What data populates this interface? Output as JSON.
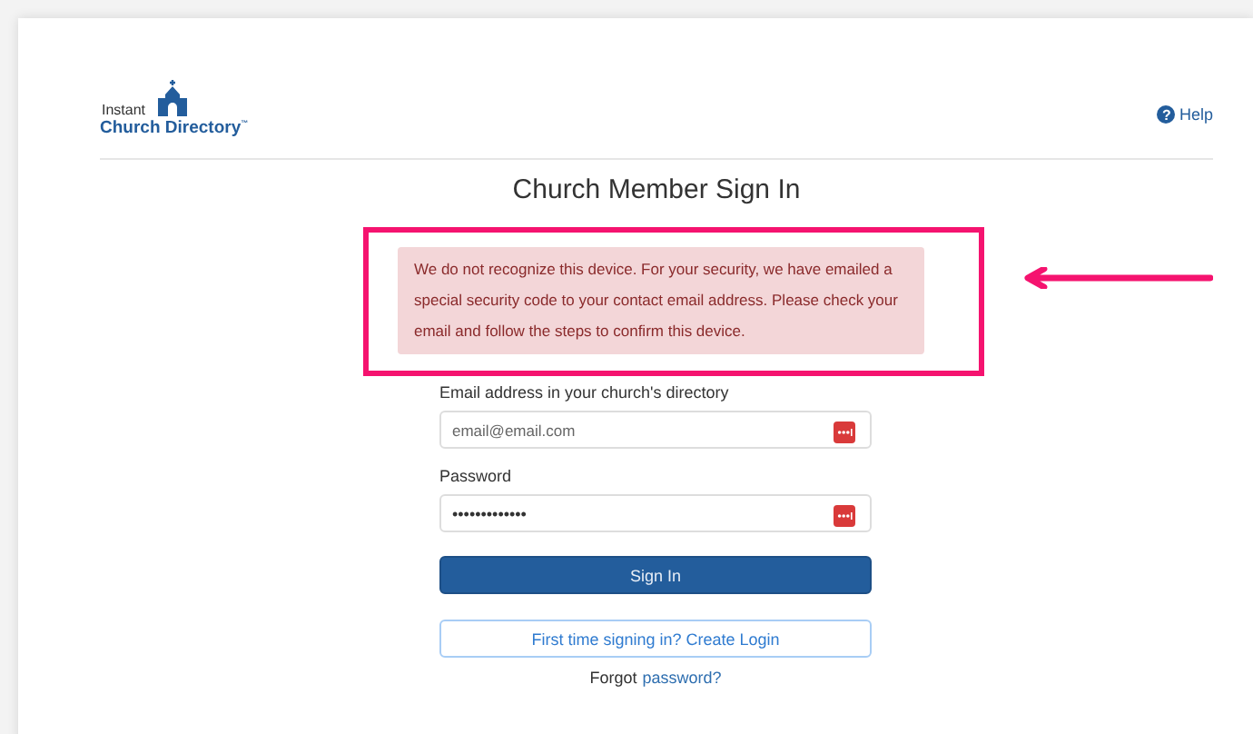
{
  "header": {
    "logo": {
      "line_1": "Instant",
      "line_2": "Church Directory",
      "mark": "™"
    },
    "help_icon": "?",
    "help": "Help"
  },
  "title": "Church Member Sign In",
  "alert": {
    "text": "We do not recognize this device. For your security, we have emailed a special security code to your contact email address. Please check your email and follow the steps to confirm this device."
  },
  "annotation": {
    "highlight": true,
    "arrow": true
  },
  "form": {
    "fields": [
      {
        "label": "Email address in your church's directory",
        "value": "email@email.com"
      },
      {
        "label": "Password",
        "value": "•••••••••••••"
      }
    ],
    "sign_in": "Sign In",
    "create_login": "First time signing in? Create Login",
    "forgot_text": "Forgot",
    "forgot_link": "password?"
  }
}
